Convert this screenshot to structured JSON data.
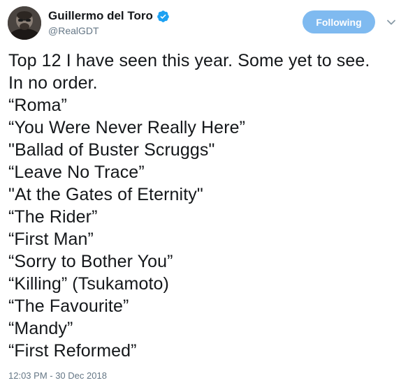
{
  "author": {
    "display_name": "Guillermo del Toro",
    "handle": "@RealGDT",
    "verified_icon": "verified-badge-icon",
    "avatar_icon": "profile-photo"
  },
  "actions": {
    "follow_label": "Following",
    "menu_icon": "chevron-down-icon"
  },
  "colors": {
    "follow_button_bg": "#7fbaf0",
    "verified": "#1da1f2",
    "text": "#14171a",
    "muted": "#657786"
  },
  "tweet": {
    "lines": [
      "Top 12 I have seen this year.  Some yet to see.",
      "In no order.",
      "“Roma”",
      "“You Were Never Really Here”",
      "\"Ballad of Buster Scruggs\"",
      "“Leave No Trace”",
      "\"At the Gates of Eternity\"",
      "“The Rider”",
      "“First Man”",
      "“Sorry to Bother You”",
      "“Killing” (Tsukamoto)",
      "“The Favourite”",
      "“Mandy”",
      "“First Reformed”"
    ],
    "timestamp": "12:03 PM - 30 Dec 2018"
  }
}
